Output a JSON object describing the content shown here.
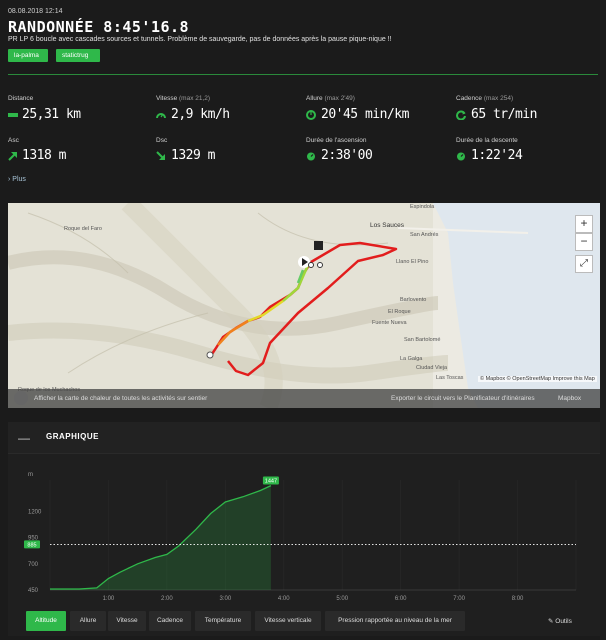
{
  "header": {
    "date": "08.08.2018 12:14",
    "title": "RANDONNÉE 8:45'16.8",
    "description": "PR LP 6 boucle avec cascades sources et tunnels. Problème de sauvegarde, pas de données après la pause pique-nique !!",
    "tags": [
      "la-palma",
      "statictrug"
    ]
  },
  "stats": {
    "distance": {
      "label": "Distance",
      "value": "25,31 km",
      "icon": "ruler-icon"
    },
    "vitesse": {
      "label": "Vitesse",
      "sub": "(max  21,2)",
      "value": "2,9 km/h",
      "icon": "speedometer-icon"
    },
    "allure": {
      "label": "Allure",
      "sub": "(max  2'49)",
      "value": "20'45 min/km",
      "icon": "pace-icon"
    },
    "cadence": {
      "label": "Cadence",
      "sub": "(max  254)",
      "value": "65 tr/min",
      "icon": "cadence-icon"
    },
    "asc": {
      "label": "Asc",
      "value": "1318 m",
      "icon": "arrow-up-right-icon"
    },
    "dsc": {
      "label": "Dsc",
      "value": "1329 m",
      "icon": "arrow-down-right-icon"
    },
    "duree_asc": {
      "label": "Durée de l'ascension",
      "value": "2:38'00",
      "icon": "timer-icon"
    },
    "duree_desc": {
      "label": "Durée de la descente",
      "value": "1:22'24",
      "icon": "timer-icon"
    }
  },
  "plus_link": "Plus",
  "map": {
    "places": [
      "Roque del Faro",
      "Espindola",
      "Los Sauces",
      "San Andrés",
      "Llano El Pino",
      "Barlovento",
      "El Roque",
      "Fuente Nueva",
      "San Bartolomé",
      "La Galga",
      "Las Toscas",
      "Ciudad Vieja",
      "Roque de los Muchachos"
    ],
    "zoom_in": "+",
    "zoom_out": "−",
    "fullscreen": "⤢",
    "attribution": "© Mapbox © OpenStreetMap  Improve this Map",
    "heatmap_text": "Afficher la carte de chaleur de toutes les activités sur sentier",
    "export_text": "Exporter le circuit vers le Planificateur d'itinéraires",
    "mapbox_logo": "Mapbox"
  },
  "graph": {
    "collapse": "—",
    "title": "GRAPHIQUE",
    "y_unit": "m",
    "y_ticks": [
      "1200",
      "950",
      "700",
      "450"
    ],
    "x_ticks": [
      "1:00",
      "2:00",
      "3:00",
      "4:00",
      "5:00",
      "6:00",
      "7:00",
      "8:00"
    ],
    "max_badge": "1447",
    "avg_badge": "885",
    "tools_label": "Outils"
  },
  "tabs": [
    "Altitude",
    "Allure",
    "Vitesse",
    "Cadence",
    "Température",
    "Vitesse verticale",
    "Pression rapportée au niveau de la mer"
  ],
  "chart_data": {
    "type": "area",
    "x_unit": "h:mm",
    "ylabel": "m",
    "ylim": [
      450,
      1500
    ],
    "x": [
      0.0,
      0.3,
      0.5,
      0.8,
      1.0,
      1.2,
      1.5,
      1.8,
      2.0,
      2.2,
      2.5,
      2.75,
      3.0,
      3.3,
      3.6,
      3.78
    ],
    "values": [
      460,
      460,
      460,
      470,
      560,
      620,
      700,
      760,
      790,
      870,
      1030,
      1180,
      1290,
      1340,
      1400,
      1447
    ],
    "max": 1447,
    "average": 885
  },
  "colors": {
    "accent": "#2fb84a",
    "route": "#e21d1d",
    "background": "#1b1b1b"
  }
}
